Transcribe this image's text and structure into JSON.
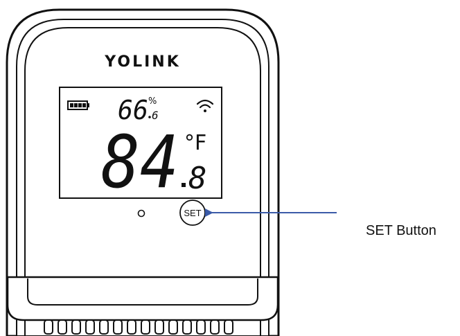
{
  "device": {
    "brand": "YOLINK",
    "humidity_value": "66",
    "humidity_decimal": "6",
    "humidity_unit": "%",
    "temperature_value": "84",
    "temperature_decimal": "8",
    "temperature_unit": "°F",
    "set_button_label": "SET"
  },
  "callout": {
    "label": "SET Button",
    "arrow_color": "#3b5ba8"
  },
  "icons": {
    "battery": "battery-full-icon",
    "wifi": "wifi-icon",
    "indicator": "led-indicator"
  }
}
